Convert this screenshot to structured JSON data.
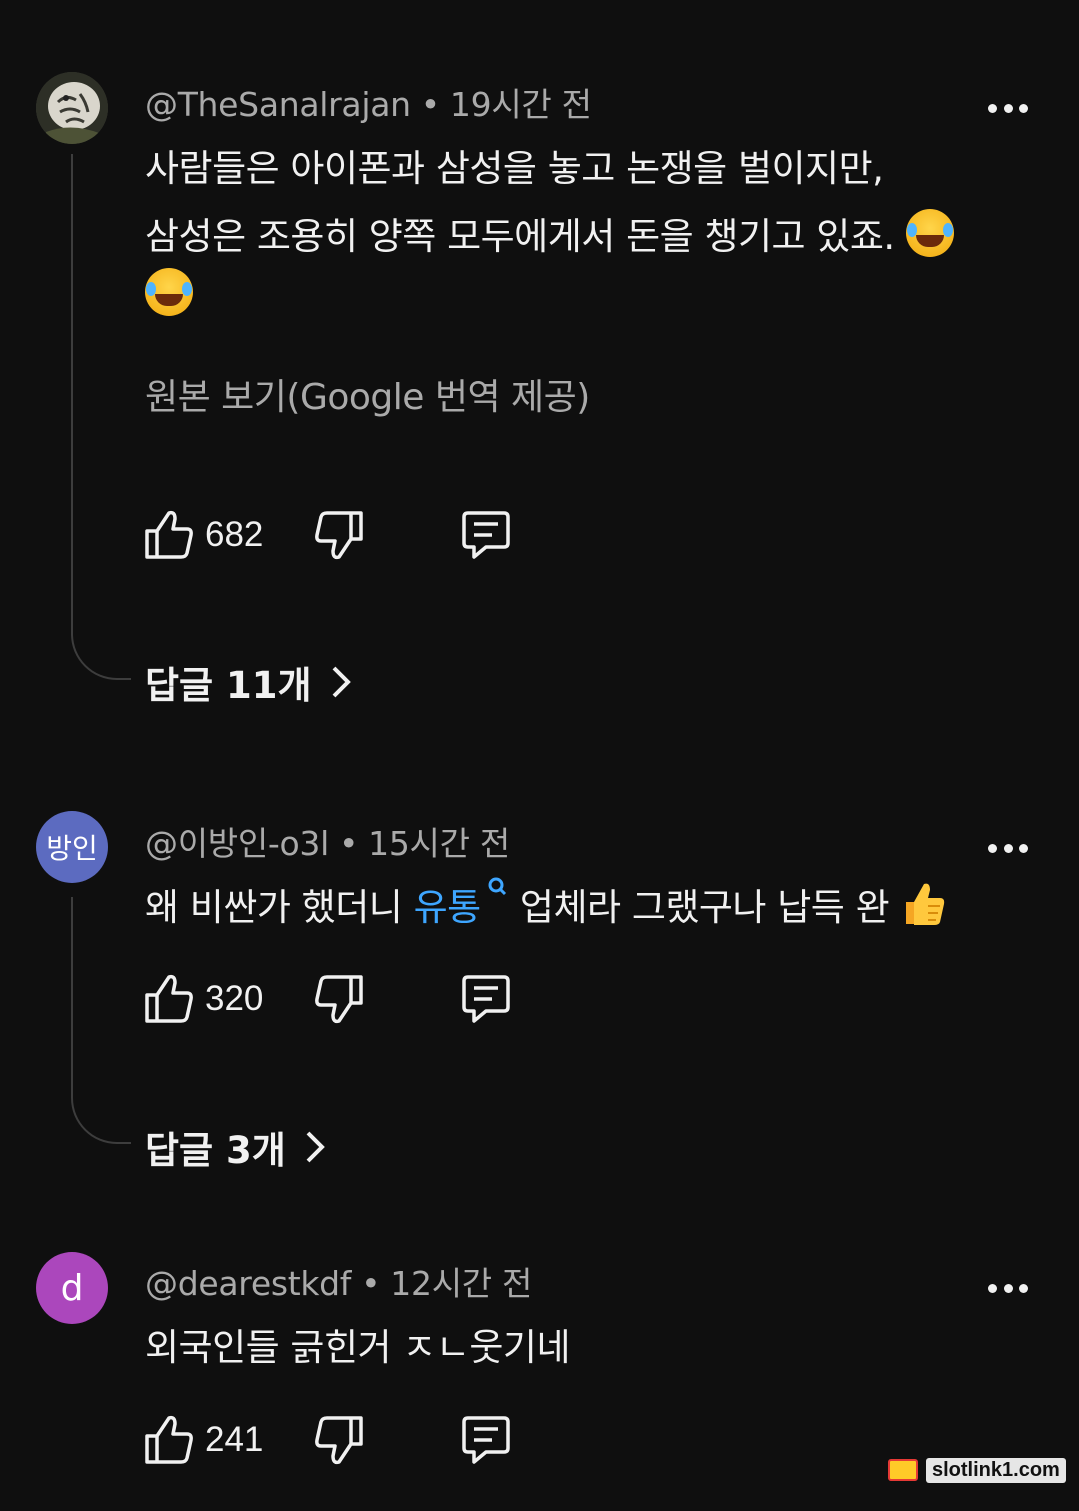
{
  "comments": [
    {
      "author": "@TheSanalrajan",
      "separator": "•",
      "time": "19시간 전",
      "text_line1": "사람들은 아이폰과 삼성을 놓고 논쟁을 벌이지만,",
      "text_line2": "삼성은 조용히 양쪽 모두에게서 돈을 챙기고 있죠.",
      "emoji": "face-with-tears-of-joy",
      "translate_label": "원본 보기(Google 번역 제공)",
      "likes": "682",
      "replies_label": "답글 11개"
    },
    {
      "author": "@이방인-o3l",
      "separator": "•",
      "time": "15시간 전",
      "avatar_text": "방인",
      "avatar_color": "#5c6bc0",
      "text_before": "왜 비싼가 했더니 ",
      "text_link": "유통",
      "text_after": " 업체라 그랬구나 납득 완",
      "emoji": "thumbs-up",
      "likes": "320",
      "replies_label": "답글 3개"
    },
    {
      "author": "@dearestkdf",
      "separator": "•",
      "time": "12시간 전",
      "avatar_text": "d",
      "avatar_color": "#ab47bc",
      "text": "외국인들 긁힌거 ㅈㄴ웃기네",
      "likes": "241"
    }
  ],
  "watermark": "slotlink1.com",
  "colors": {
    "background": "#0f0f0f",
    "text": "#f1f1f1",
    "secondary_text": "#aaaaaa",
    "link": "#3ea6ff"
  }
}
